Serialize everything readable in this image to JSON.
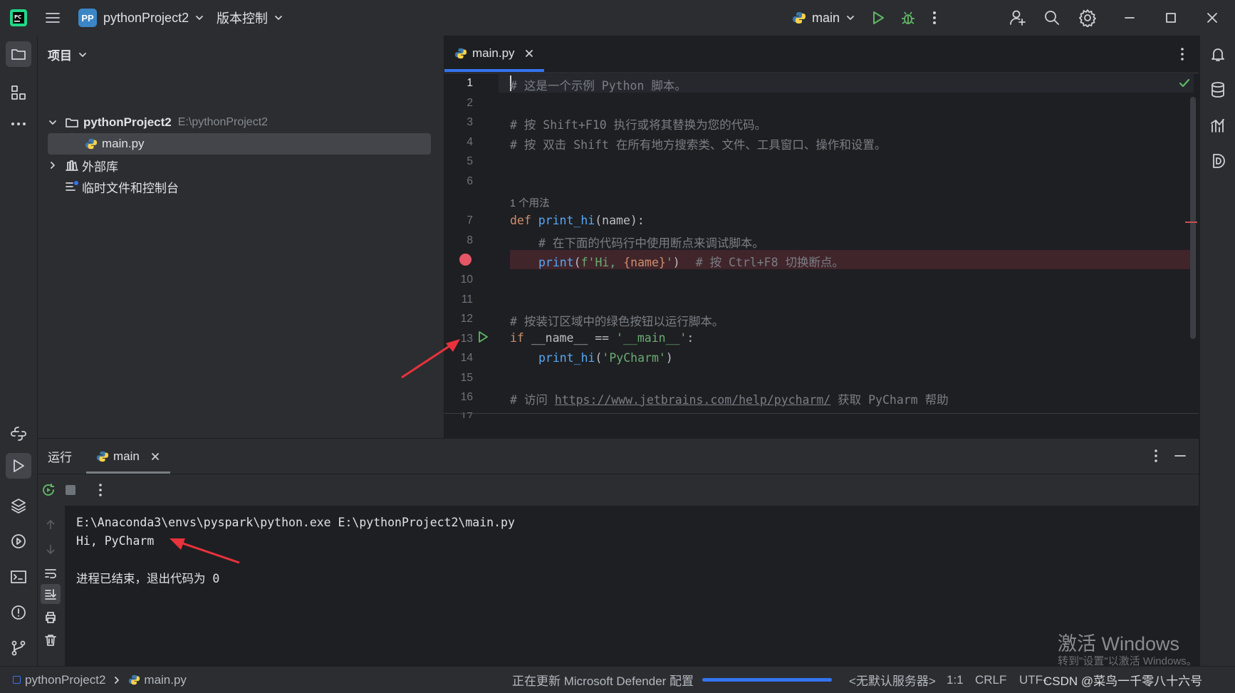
{
  "titlebar": {
    "project_badge": "PP",
    "project_name": "pythonProject2",
    "vcs_menu": "版本控制",
    "run_config": "main"
  },
  "project_panel": {
    "title": "项目",
    "root_name": "pythonProject2",
    "root_path": "E:\\pythonProject2",
    "file": "main.py",
    "external_libs": "外部库",
    "scratches": "临时文件和控制台"
  },
  "editor": {
    "tab": "main.py",
    "usage_hint": "1 个用法",
    "lines": {
      "l1": "# 这是一个示例 Python 脚本。",
      "l3": "# 按 Shift+F10 执行或将其替换为您的代码。",
      "l4": "# 按 双击 Shift 在所有地方搜索类、文件、工具窗口、操作和设置。",
      "l7_kw": "def ",
      "l7_fn": "print_hi",
      "l7_rest": "(name):",
      "l8": "# 在下面的代码行中使用断点来调试脚本。",
      "l9_fn": "print",
      "l9_p1": "(",
      "l9_s1": "f'Hi, ",
      "l9_var": "{name}",
      "l9_s2": "'",
      "l9_p2": ")",
      "l9_cmt": "# 按 Ctrl+F8 切换断点。",
      "l12": "# 按装订区域中的绿色按钮以运行脚本。",
      "l13_kw": "if ",
      "l13_mid": "__name__ == ",
      "l13_str": "'__main__'",
      "l13_end": ":",
      "l14_fn": "print_hi",
      "l14_p1": "(",
      "l14_str": "'PyCharm'",
      "l14_p2": ")",
      "l16_a": "# 访问 ",
      "l16_url": "https://www.jetbrains.com/help/pycharm/",
      "l16_b": " 获取 PyCharm 帮助"
    },
    "line_numbers": [
      "1",
      "2",
      "3",
      "4",
      "5",
      "6",
      "7",
      "8",
      "10",
      "11",
      "12",
      "13",
      "14",
      "15",
      "16",
      "17"
    ]
  },
  "run_panel": {
    "title": "运行",
    "tab": "main",
    "output": [
      "E:\\Anaconda3\\envs\\pyspark\\python.exe E:\\pythonProject2\\main.py",
      "Hi, PyCharm",
      "进程已结束，退出代码为 0"
    ]
  },
  "statusbar": {
    "breadcrumb_project": "pythonProject2",
    "breadcrumb_file": "main.py",
    "task": "正在更新 Microsoft Defender 配置",
    "task_progress": 1.0,
    "server": "<无默认服务器>",
    "position": "1:1",
    "line_sep": "CRLF",
    "encoding": "UTF-8"
  },
  "watermark": {
    "line1": "激活 Windows",
    "line2": "转到\"设置\"以激活 Windows。",
    "csdn": "CSDN @菜鸟一千零八十六号"
  },
  "colors": {
    "accent": "#3574f0",
    "run_green": "#5fb865",
    "breakpoint": "#e55765",
    "annotation_arrow": "#e8323c"
  }
}
